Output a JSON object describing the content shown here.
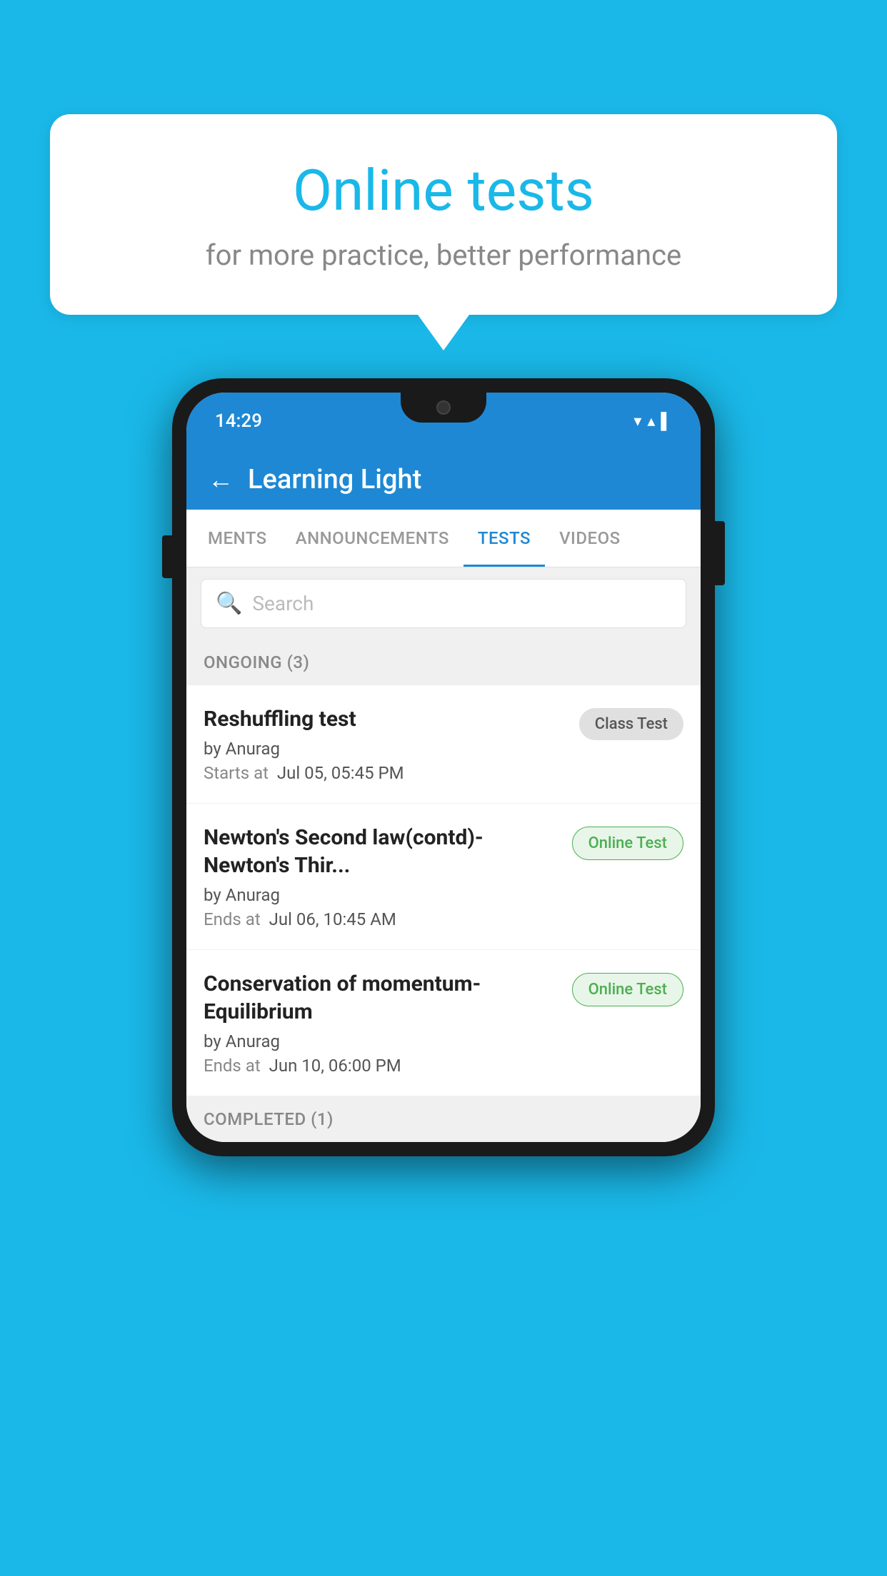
{
  "background": {
    "color": "#1ab8e8"
  },
  "speech_bubble": {
    "title": "Online tests",
    "subtitle": "for more practice, better performance"
  },
  "phone": {
    "status_bar": {
      "time": "14:29",
      "wifi_icon": "▼",
      "signal_icon": "▲",
      "battery_icon": "▌"
    },
    "app_header": {
      "back_label": "←",
      "title": "Learning Light"
    },
    "tabs": [
      {
        "label": "MENTS",
        "active": false
      },
      {
        "label": "ANNOUNCEMENTS",
        "active": false
      },
      {
        "label": "TESTS",
        "active": true
      },
      {
        "label": "VIDEOS",
        "active": false
      }
    ],
    "search": {
      "placeholder": "Search"
    },
    "sections": [
      {
        "header": "ONGOING (3)",
        "items": [
          {
            "title": "Reshuffling test",
            "author": "by Anurag",
            "date_label": "Starts at",
            "date": "Jul 05, 05:45 PM",
            "badge": "Class Test",
            "badge_type": "class"
          },
          {
            "title": "Newton's Second law(contd)-Newton's Thir...",
            "author": "by Anurag",
            "date_label": "Ends at",
            "date": "Jul 06, 10:45 AM",
            "badge": "Online Test",
            "badge_type": "online"
          },
          {
            "title": "Conservation of momentum-Equilibrium",
            "author": "by Anurag",
            "date_label": "Ends at",
            "date": "Jun 10, 06:00 PM",
            "badge": "Online Test",
            "badge_type": "online"
          }
        ]
      },
      {
        "header": "COMPLETED (1)",
        "items": []
      }
    ]
  }
}
